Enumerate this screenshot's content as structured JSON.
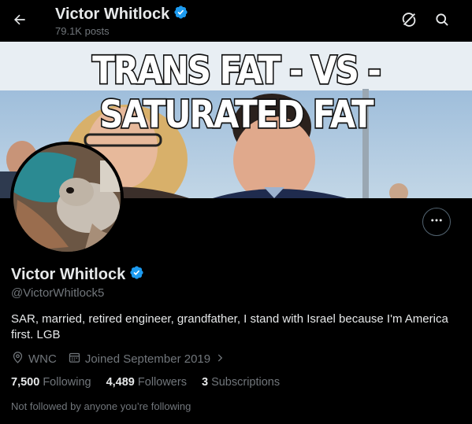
{
  "header": {
    "name": "Victor Whitlock",
    "posts": "79.1K posts",
    "back_icon": "arrow-left-icon",
    "grok_icon": "grok-icon",
    "search_icon": "search-icon"
  },
  "banner": {
    "text": "TRANS FAT - VS - SATURATED FAT"
  },
  "profile": {
    "display_name": "Victor Whitlock",
    "handle": "@VictorWhitlock5",
    "bio": "SAR, married, retired engineer, grandfather, I stand with Israel because I'm America first. LGB",
    "location": "WNC",
    "joined": "Joined September 2019",
    "verified_color": "#1d9bf0",
    "more_icon": "more-horizontal-icon"
  },
  "stats": {
    "following_count": "7,500",
    "following_label": "Following",
    "followers_count": "4,489",
    "followers_label": "Followers",
    "subscriptions_count": "3",
    "subscriptions_label": "Subscriptions"
  },
  "followed_by": "Not followed by anyone you’re following"
}
